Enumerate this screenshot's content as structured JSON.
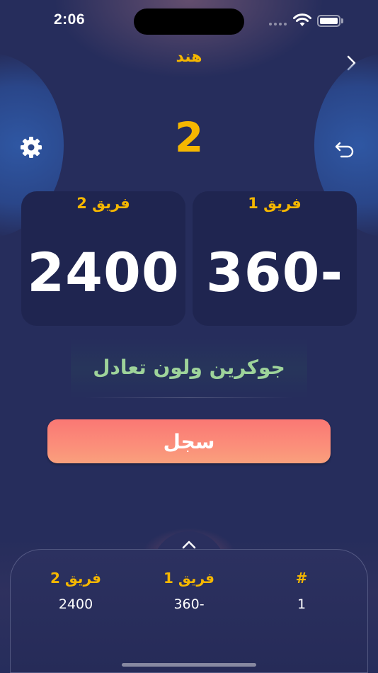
{
  "status_bar": {
    "time": "2:06"
  },
  "header": {
    "title": "هند"
  },
  "round": {
    "number": "2"
  },
  "teams": [
    {
      "label": "فريق 2",
      "score": "2400"
    },
    {
      "label": "فريق 1",
      "score": "360-"
    }
  ],
  "game": {
    "name": "جوكرين ولون تعادل"
  },
  "actions": {
    "record_label": "سجل"
  },
  "history": {
    "headers": {
      "team2": "فريق 2",
      "team1": "فريق 1",
      "index": "#"
    },
    "rows": [
      {
        "team2": "2400",
        "team1": "360-",
        "index": "1"
      }
    ]
  },
  "icons": {
    "back": "chevron-right-icon",
    "settings": "gear-icon",
    "undo": "undo-icon",
    "expand": "chevron-up-icon"
  },
  "colors": {
    "accent": "#f5b700",
    "background": "#262d5c",
    "card": "#1f2550",
    "game_name": "#9ed39a",
    "record_button": "#fa8a78"
  }
}
